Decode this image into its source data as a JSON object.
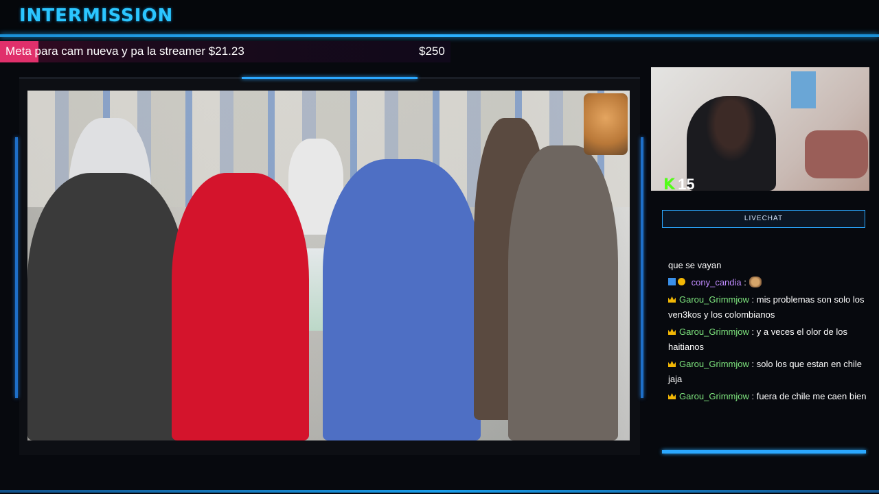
{
  "header": {
    "title": "INTERMISSION"
  },
  "goal": {
    "label": "Meta",
    "description": "para cam nueva y pa la streamer",
    "current": "$21.23",
    "target": "$250",
    "progress_fraction": 0.085,
    "accent_color": "#e0306b"
  },
  "webcam": {
    "viewer_icon": "kick-logo-icon",
    "viewer_count": "15"
  },
  "chat": {
    "title": "LIVECHAT",
    "messages": [
      {
        "user": "",
        "user_color": "#ffffff",
        "badges": [],
        "text": "que se vayan"
      },
      {
        "user": "cony_candia",
        "user_color": "#c08bff",
        "badges": [
          "blue-badge",
          "gold-badge"
        ],
        "text": "",
        "emote": "cat-emote"
      },
      {
        "user": "Garou_Grimmjow",
        "user_color": "#7ee57e",
        "badges": [
          "crown"
        ],
        "text": "mis problemas son solo los ven3kos y los colombianos"
      },
      {
        "user": "Garou_Grimmjow",
        "user_color": "#7ee57e",
        "badges": [
          "crown"
        ],
        "text": "y a veces el olor de los haitianos"
      },
      {
        "user": "Garou_Grimmjow",
        "user_color": "#7ee57e",
        "badges": [
          "crown"
        ],
        "text": "solo los que estan en chile jaja"
      },
      {
        "user": "Garou_Grimmjow",
        "user_color": "#7ee57e",
        "badges": [
          "crown"
        ],
        "text": "fuera de chile me caen bien"
      }
    ]
  },
  "colors": {
    "accent_blue": "#2ba8ff",
    "background": "#07090e"
  }
}
